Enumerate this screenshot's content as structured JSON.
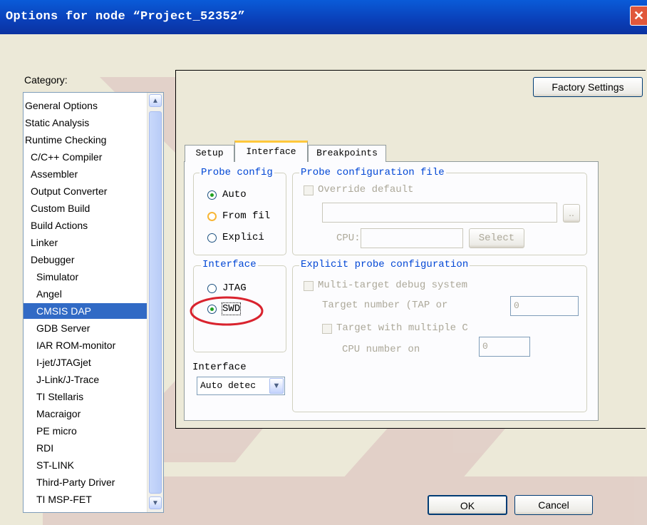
{
  "window": {
    "title": "Options for node “Project_52352”",
    "close_glyph": "✕"
  },
  "category": {
    "label": "Category:",
    "items": [
      {
        "label": "General Options",
        "indent": 0
      },
      {
        "label": "Static Analysis",
        "indent": 0
      },
      {
        "label": "Runtime Checking",
        "indent": 0
      },
      {
        "label": "C/C++ Compiler",
        "indent": 1
      },
      {
        "label": "Assembler",
        "indent": 1
      },
      {
        "label": "Output Converter",
        "indent": 1
      },
      {
        "label": "Custom Build",
        "indent": 1
      },
      {
        "label": "Build Actions",
        "indent": 1
      },
      {
        "label": "Linker",
        "indent": 1
      },
      {
        "label": "Debugger",
        "indent": 1
      },
      {
        "label": "Simulator",
        "indent": 2
      },
      {
        "label": "Angel",
        "indent": 2
      },
      {
        "label": "CMSIS DAP",
        "indent": 2,
        "selected": true
      },
      {
        "label": "GDB Server",
        "indent": 2
      },
      {
        "label": "IAR ROM-monitor",
        "indent": 2
      },
      {
        "label": "I-jet/JTAGjet",
        "indent": 2
      },
      {
        "label": "J-Link/J-Trace",
        "indent": 2
      },
      {
        "label": "TI Stellaris",
        "indent": 2
      },
      {
        "label": "Macraigor",
        "indent": 2
      },
      {
        "label": "PE micro",
        "indent": 2
      },
      {
        "label": "RDI",
        "indent": 2
      },
      {
        "label": "ST-LINK",
        "indent": 2
      },
      {
        "label": "Third-Party Driver",
        "indent": 2
      },
      {
        "label": "TI MSP-FET",
        "indent": 2
      }
    ]
  },
  "factory_settings": "Factory Settings",
  "tabs": [
    "Setup",
    "Interface",
    "Breakpoints"
  ],
  "active_tab": "Interface",
  "probe_config": {
    "legend": "Probe config",
    "options": [
      "Auto",
      "From fil",
      "Explici"
    ],
    "selected": "Auto"
  },
  "probe_file": {
    "legend": "Probe configuration file",
    "override_label": "Override default",
    "path_value": "",
    "browse_label": "..",
    "cpu_label": "CPU:",
    "cpu_value": "",
    "select_label": "Select"
  },
  "interface_group": {
    "legend": "Interface",
    "options": [
      "JTAG",
      "SWD"
    ],
    "selected": "SWD"
  },
  "explicit": {
    "legend": "Explicit probe configuration",
    "multi_target_label": "Multi-target debug system",
    "target_number_label": "Target number (TAP or",
    "target_number_value": "0",
    "target_multiple_label": "Target with multiple C",
    "cpu_number_label": "CPU number on",
    "cpu_number_value": "0"
  },
  "interface_speed": {
    "label": "Interface",
    "value": "Auto detec"
  },
  "buttons": {
    "ok": "OK",
    "cancel": "Cancel"
  },
  "colors": {
    "title_bar": "#0a4fc8",
    "selection": "#316ac5",
    "annotation_circle": "#d9232e",
    "group_legend": "#0046d5"
  }
}
